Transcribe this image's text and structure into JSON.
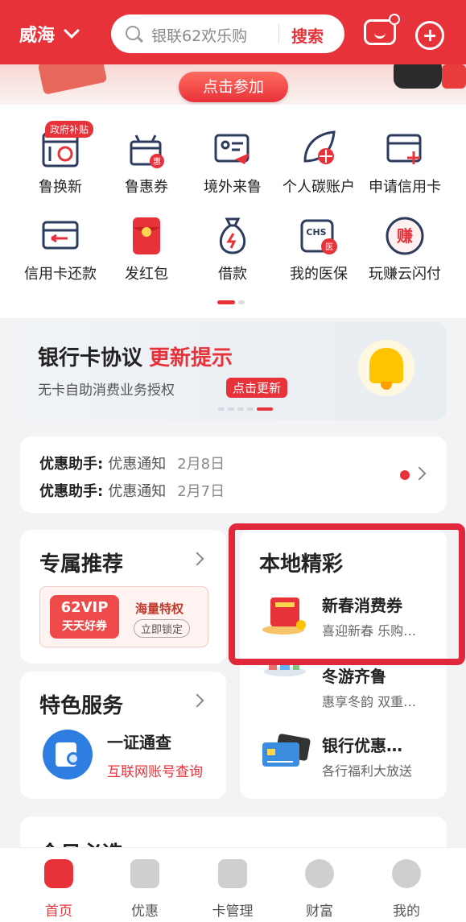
{
  "header": {
    "city": "威海",
    "search_placeholder": "银联62欢乐购",
    "search_button": "搜索"
  },
  "banner": {
    "join_button": "点击参加"
  },
  "shortcuts": {
    "gov_badge": "政府补贴",
    "row1": [
      "鲁换新",
      "鲁惠券",
      "境外来鲁",
      "个人碳账户",
      "申请信用卡"
    ],
    "row2": [
      "信用卡还款",
      "发红包",
      "借款",
      "我的医保",
      "玩赚云闪付"
    ],
    "icons": {
      "chs_text": "CHS",
      "hui_text": "惠",
      "yi_text": "医",
      "zhuan_text": "赚"
    }
  },
  "notice": {
    "title": "银行卡协议",
    "title_highlight": "更新提示",
    "subtitle": "无卡自助消费业务授权",
    "button": "点击更新"
  },
  "assistant": {
    "rows": [
      {
        "label": "优惠助手:",
        "text": "优惠通知",
        "date": "2月8日"
      },
      {
        "label": "优惠助手:",
        "text": "优惠通知",
        "date": "2月7日"
      }
    ]
  },
  "recommend": {
    "title": "专属推荐",
    "vip_line1": "62VIP",
    "vip_line2": "天天好券",
    "privilege": "海量特权",
    "lock_button": "立即锁定"
  },
  "services": {
    "title": "特色服务",
    "item_title": "一证通查",
    "item_subtitle": "互联网账号查询"
  },
  "local": {
    "title": "本地精彩",
    "items": [
      {
        "title": "新春消费券",
        "subtitle": "喜迎新春 乐购…"
      },
      {
        "title": "冬游齐鲁",
        "subtitle": "惠享冬韵 双重…"
      },
      {
        "title": "银行优惠…",
        "subtitle": "各行福利大放送"
      }
    ]
  },
  "bottom_card": {
    "title": "今日必选"
  },
  "tabbar": {
    "items": [
      "首页",
      "优惠",
      "卡管理",
      "财富",
      "我的"
    ]
  },
  "colors": {
    "brand_red": "#e8323a",
    "highlight_border": "#e0283a"
  }
}
